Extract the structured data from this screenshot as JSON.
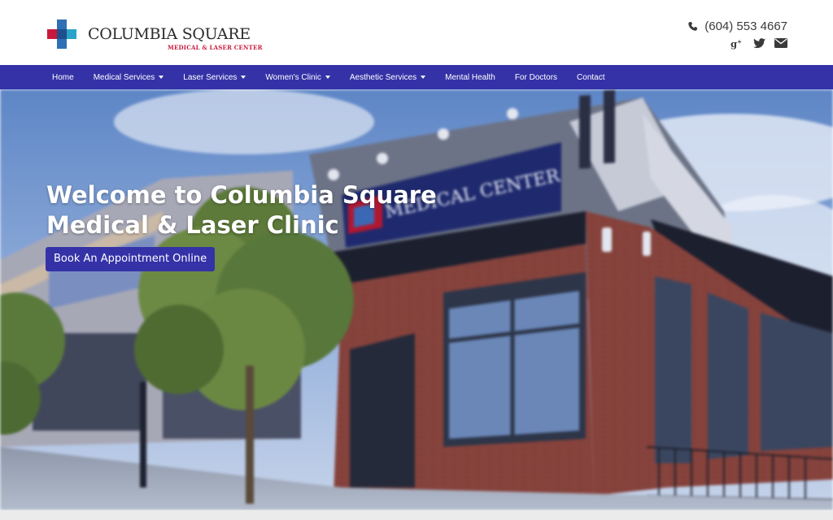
{
  "brand": {
    "name": "COLUMBIA SQUARE",
    "tagline": "MEDICAL & LASER CENTER"
  },
  "contact": {
    "phone": "(604) 553 4667",
    "social": [
      "google-plus-icon",
      "twitter-icon",
      "envelope-icon"
    ]
  },
  "nav": {
    "items": [
      {
        "label": "Home",
        "dropdown": false
      },
      {
        "label": "Medical Services",
        "dropdown": true
      },
      {
        "label": "Laser Services",
        "dropdown": true
      },
      {
        "label": "Women's Clinic",
        "dropdown": true
      },
      {
        "label": "Aesthetic Services",
        "dropdown": true
      },
      {
        "label": "Mental Health",
        "dropdown": false
      },
      {
        "label": "For Doctors",
        "dropdown": false
      },
      {
        "label": "Contact",
        "dropdown": false
      }
    ]
  },
  "hero": {
    "title_line1": "Welcome to Columbia Square",
    "title_line2": "Medical & Laser Clinic",
    "cta_label": "Book An Appointment Online",
    "sign_text": "MEDICAL CENTER"
  },
  "colors": {
    "nav_bg": "#3532a8",
    "brand_red": "#c8193c",
    "brand_blue": "#2f6fb6",
    "brand_teal": "#2aa3c9"
  }
}
